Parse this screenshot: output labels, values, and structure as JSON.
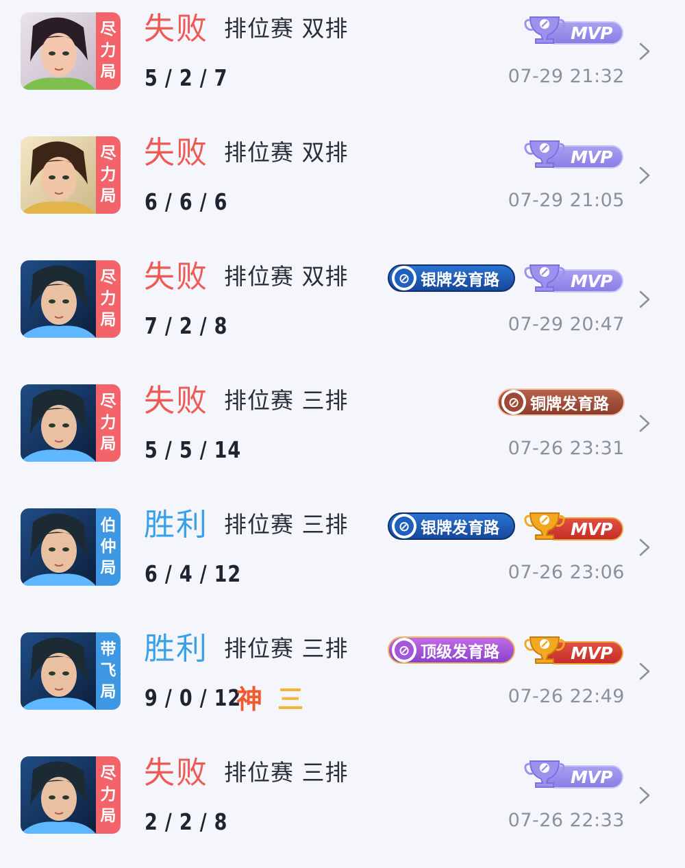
{
  "colors": {
    "lose_text": "#f05a55",
    "win_text": "#3aa0e8",
    "tag_red": "#f2636a",
    "tag_blue": "#3d97e3",
    "background": "#f5f6fb"
  },
  "matches": [
    {
      "hero": "hero-icon-green",
      "tag": [
        "尽",
        "力",
        "局"
      ],
      "tag_color": "red",
      "result": "失败",
      "outcome": "lose",
      "mode": "排位赛 双排",
      "kda": "5 / 2 / 7",
      "extra": [],
      "badges": [
        {
          "type": "mvp",
          "variant": "lose",
          "label": "MVP"
        }
      ],
      "time": "07-29 21:32"
    },
    {
      "hero": "hero-icon-gold",
      "tag": [
        "尽",
        "力",
        "局"
      ],
      "tag_color": "red",
      "result": "失败",
      "outcome": "lose",
      "mode": "排位赛 双排",
      "kda": "6 / 6 / 6",
      "extra": [],
      "badges": [
        {
          "type": "mvp",
          "variant": "lose",
          "label": "MVP"
        }
      ],
      "time": "07-29 21:05"
    },
    {
      "hero": "hero-icon-blue",
      "tag": [
        "尽",
        "力",
        "局"
      ],
      "tag_color": "red",
      "result": "失败",
      "outcome": "lose",
      "mode": "排位赛 双排",
      "kda": "7 / 2 / 8",
      "extra": [],
      "badges": [
        {
          "type": "route",
          "variant": "silver",
          "label": "银牌发育路"
        },
        {
          "type": "mvp",
          "variant": "lose",
          "label": "MVP"
        }
      ],
      "time": "07-29 20:47"
    },
    {
      "hero": "hero-icon-blue",
      "tag": [
        "尽",
        "力",
        "局"
      ],
      "tag_color": "red",
      "result": "失败",
      "outcome": "lose",
      "mode": "排位赛 三排",
      "kda": "5 / 5 / 14",
      "extra": [],
      "badges": [
        {
          "type": "route",
          "variant": "bronze",
          "label": "铜牌发育路"
        }
      ],
      "time": "07-26 23:31"
    },
    {
      "hero": "hero-icon-blue",
      "tag": [
        "伯",
        "仲",
        "局"
      ],
      "tag_color": "blue",
      "result": "胜利",
      "outcome": "win",
      "mode": "排位赛 三排",
      "kda": "6 / 4 / 12",
      "extra": [],
      "badges": [
        {
          "type": "route",
          "variant": "silver",
          "label": "银牌发育路"
        },
        {
          "type": "mvp",
          "variant": "win",
          "label": "MVP"
        }
      ],
      "time": "07-26 23:06"
    },
    {
      "hero": "hero-icon-blue",
      "tag": [
        "带",
        "飞",
        "局"
      ],
      "tag_color": "blue",
      "result": "胜利",
      "outcome": "win",
      "mode": "排位赛 三排",
      "kda": "9 / 0 / 12",
      "extra": [
        "神",
        "三"
      ],
      "badges": [
        {
          "type": "route",
          "variant": "top",
          "label": "顶级发育路"
        },
        {
          "type": "mvp",
          "variant": "win",
          "label": "MVP"
        }
      ],
      "time": "07-26 22:49"
    },
    {
      "hero": "hero-icon-blue",
      "tag": [
        "尽",
        "力",
        "局"
      ],
      "tag_color": "red",
      "result": "失败",
      "outcome": "lose",
      "mode": "排位赛 三排",
      "kda": "2 / 2 / 8",
      "extra": [],
      "badges": [
        {
          "type": "mvp",
          "variant": "lose",
          "label": "MVP"
        }
      ],
      "time": "07-26 22:33"
    }
  ]
}
